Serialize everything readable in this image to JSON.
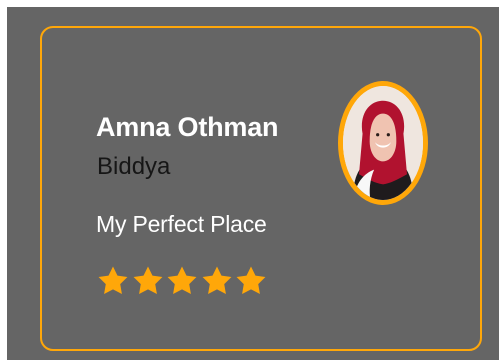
{
  "profile": {
    "name": "Amna Othman",
    "subtitle": "Biddya",
    "place": "My Perfect Place",
    "rating": 5,
    "rating_max": 5
  },
  "icons": {
    "star": "star-icon",
    "avatar": "profile-photo"
  },
  "colors": {
    "panel": "#656565",
    "accent": "#ffa709",
    "name_text": "#ffffff",
    "subtitle_text": "#161616",
    "place_text": "#ffffff"
  }
}
